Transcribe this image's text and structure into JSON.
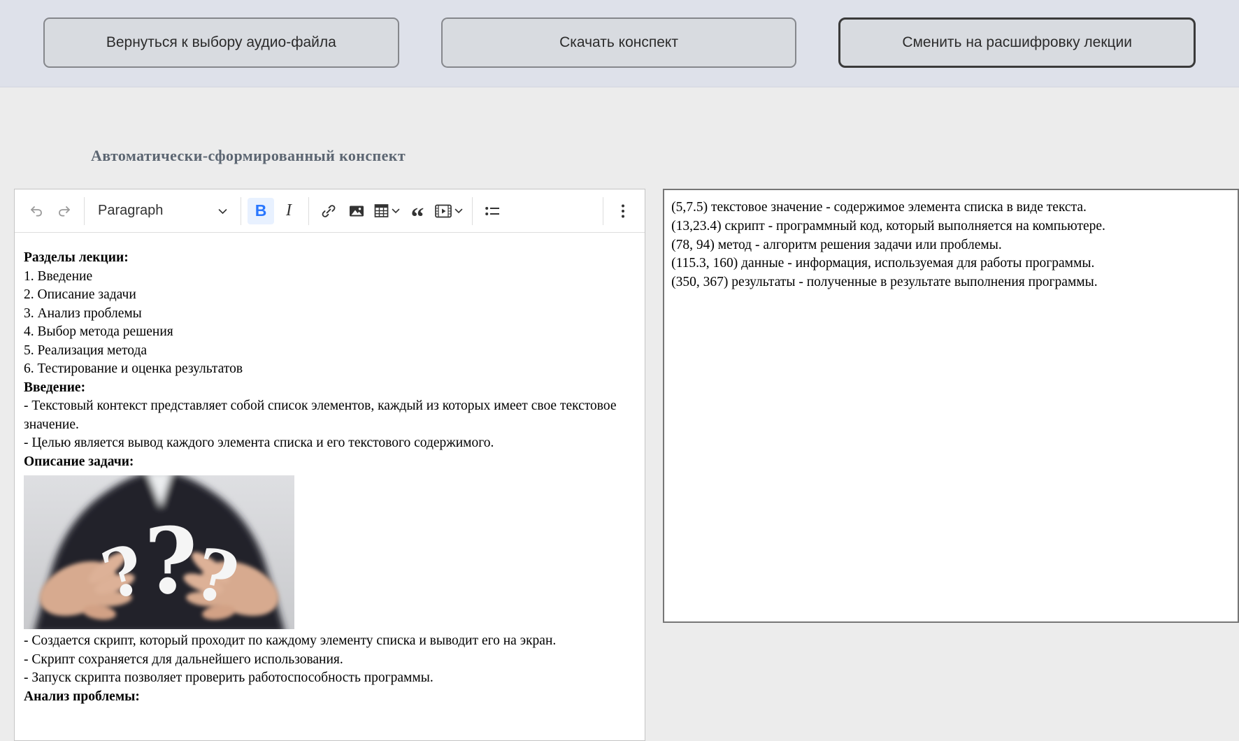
{
  "topbar": {
    "back_button": "Вернуться к выбору аудио-файла",
    "download_button": "Скачать конспект",
    "switch_button": "Сменить на расшифровку лекции"
  },
  "page": {
    "title": "Автоматически-сформированный конспект"
  },
  "editor": {
    "toolbar": {
      "paragraph_dropdown": "Paragraph",
      "icons": [
        "undo-icon",
        "redo-icon",
        "bold-icon",
        "italic-icon",
        "link-icon",
        "insert-image-icon",
        "insert-table-icon",
        "block-quote-icon",
        "media-embed-icon",
        "bulleted-list-icon",
        "more-options-icon"
      ],
      "bold_label": "B",
      "italic_label": "I",
      "quote_label": "“",
      "bold_active_color": "#2977ff"
    },
    "image_semantic": "photo-businessman-hands-holding-three-question-marks",
    "lines": [
      {
        "style": "bold",
        "text": "Разделы лекции:"
      },
      {
        "style": "normal",
        "text": "1. Введение"
      },
      {
        "style": "normal",
        "text": "2. Описание задачи"
      },
      {
        "style": "normal",
        "text": "3. Анализ проблемы"
      },
      {
        "style": "normal",
        "text": "4. Выбор метода решения"
      },
      {
        "style": "normal",
        "text": "5. Реализация метода"
      },
      {
        "style": "normal",
        "text": "6. Тестирование и оценка результатов"
      },
      {
        "style": "bold",
        "text": "Введение:"
      },
      {
        "style": "normal",
        "text": "- Текстовый контекст представляет собой список элементов, каждый из которых имеет свое текстовое значение."
      },
      {
        "style": "normal",
        "text": "- Целью является вывод каждого элемента списка и его текстового содержимого."
      },
      {
        "style": "bold",
        "text": "Описание задачи:"
      },
      {
        "style": "normal",
        "text": "- Создается скрипт, который проходит по каждому элементу списка и выводит его на экран."
      },
      {
        "style": "normal",
        "text": "- Скрипт сохраняется для дальнейшего использования."
      },
      {
        "style": "normal",
        "text": "- Запуск скрипта позволяет проверить работоспособность программы."
      },
      {
        "style": "bold",
        "text": "Анализ проблемы:"
      }
    ]
  },
  "transcript": {
    "lines": [
      "(5,7.5) текстовое значение - содержимое элемента списка в виде текста.",
      "(13,23.4) скрипт - программный код, который выполняется на компьютере.",
      "(78, 94) метод - алгоритм решения задачи или проблемы.",
      "(115.3, 160) данные - информация, используемая для работы программы.",
      "(350, 367) результаты - полученные в результате выполнения программы."
    ]
  },
  "colors": {
    "topbar_bg": "#dee1ea",
    "page_bg": "#ececec",
    "button_bg": "#d8dbe0",
    "button_border": "#85878c",
    "active_button_border": "#3a3a3a",
    "title_color": "#5c6672",
    "bold_active": "#2977ff"
  }
}
